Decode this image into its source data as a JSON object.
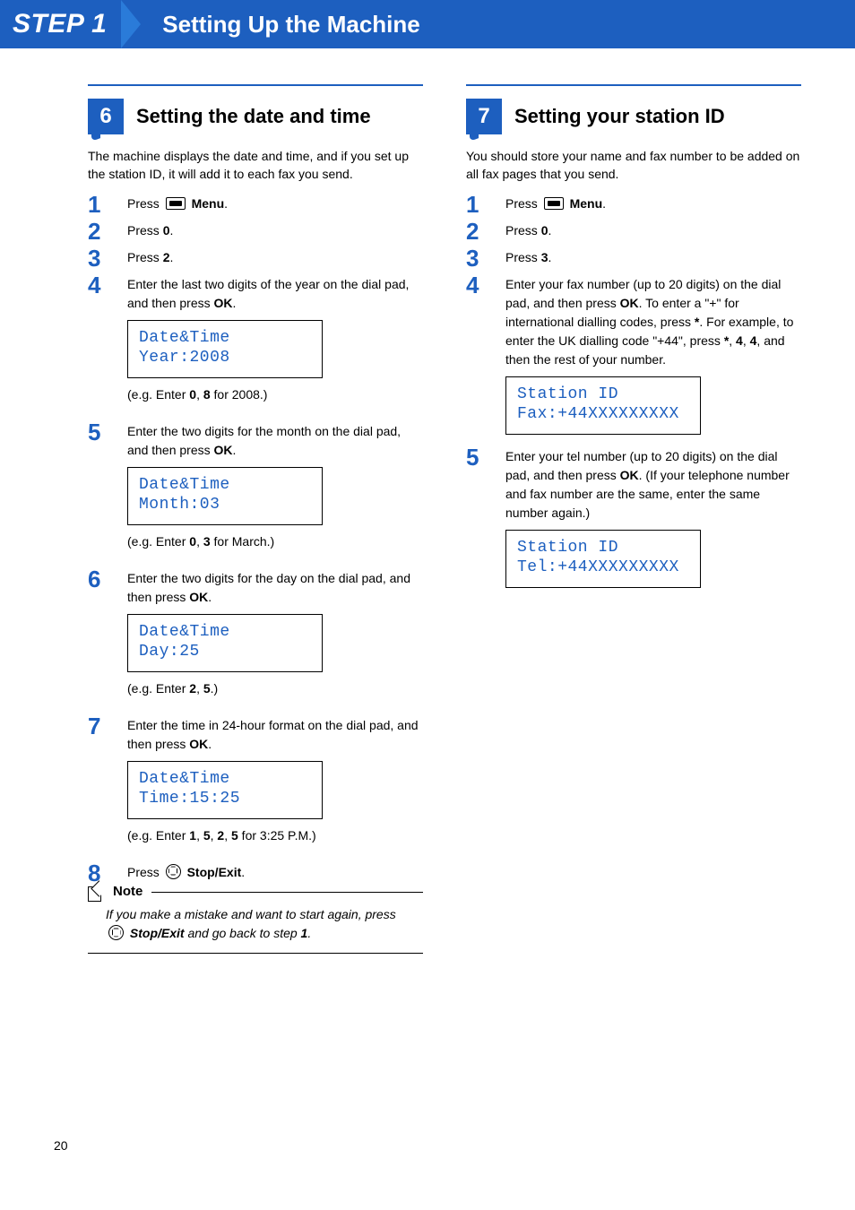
{
  "banner": {
    "step": "STEP 1",
    "title": "Setting Up the Machine"
  },
  "left": {
    "number": "6",
    "title": "Setting the date and time",
    "intro": "The machine displays the date and time, and if you set up the station ID, it will add it to each fax you send.",
    "s1_pre": "Press ",
    "s1_bold": "Menu",
    "s1_post": ".",
    "s2_pre": "Press ",
    "s2_bold": "0",
    "s2_post": ".",
    "s3_pre": "Press ",
    "s3_bold": "2",
    "s3_post": ".",
    "s4_a": "Enter the last two digits of the year on the dial pad, and then press ",
    "s4_b": "OK",
    "s4_c": ".",
    "lcd1_l1": "Date&Time",
    "lcd1_l2": "Year:2008",
    "eg1_a": "(e.g. Enter ",
    "eg1_b": "0",
    "eg1_c": ", ",
    "eg1_d": "8",
    "eg1_e": " for 2008.)",
    "s5_a": "Enter the two digits for the month on the dial pad, and then press ",
    "s5_b": "OK",
    "s5_c": ".",
    "lcd2_l1": "Date&Time",
    "lcd2_l2": "Month:03",
    "eg2_a": "(e.g. Enter ",
    "eg2_b": "0",
    "eg2_c": ", ",
    "eg2_d": "3",
    "eg2_e": " for March.)",
    "s6_a": "Enter the two digits for the day on the dial pad, and then press ",
    "s6_b": "OK",
    "s6_c": ".",
    "lcd3_l1": "Date&Time",
    "lcd3_l2": "Day:25",
    "eg3_a": "(e.g. Enter ",
    "eg3_b": "2",
    "eg3_c": ", ",
    "eg3_d": "5",
    "eg3_e": ".)",
    "s7_a": "Enter the time in 24-hour format on the dial pad, and then press ",
    "s7_b": "OK",
    "s7_c": ".",
    "lcd4_l1": "Date&Time",
    "lcd4_l2": "Time:15:25",
    "eg4_a": "(e.g. Enter ",
    "eg4_b": "1",
    "eg4_c": ", ",
    "eg4_d": "5",
    "eg4_e": ", ",
    "eg4_f": "2",
    "eg4_g": ", ",
    "eg4_h": "5",
    "eg4_i": " for 3:25 P.M.)",
    "s8_pre": "Press ",
    "s8_bold": "Stop/Exit",
    "s8_post": ".",
    "note_title": "Note",
    "note_a": "If you make a mistake and want to start again, press ",
    "note_b": "Stop/Exit",
    "note_c": " and go back to step ",
    "note_d": "1",
    "note_e": "."
  },
  "right": {
    "number": "7",
    "title": "Setting your station ID",
    "intro": "You should store your name and fax number to be added on all fax pages that you send.",
    "s1_pre": "Press ",
    "s1_bold": "Menu",
    "s1_post": ".",
    "s2_pre": "Press ",
    "s2_bold": "0",
    "s2_post": ".",
    "s3_pre": "Press ",
    "s3_bold": "3",
    "s3_post": ".",
    "s4_a": "Enter your fax number (up to 20 digits) on the dial pad, and then press ",
    "s4_b": "OK",
    "s4_c": ". To enter a \"+\" for international dialling codes, press ",
    "s4_d": "*",
    "s4_e": ". For example, to enter the UK dialling code \"+44\", press ",
    "s4_f": "*",
    "s4_g": ", ",
    "s4_h": "4",
    "s4_i": ", ",
    "s4_j": "4",
    "s4_k": ", and then the rest of your number.",
    "lcd1_l1": "Station ID",
    "lcd1_l2": "Fax:+44XXXXXXXXX",
    "s5_a": "Enter your tel number (up to 20 digits) on the dial pad, and then press ",
    "s5_b": "OK",
    "s5_c": ". (If your telephone number and fax number are the same, enter the same number again.)",
    "lcd2_l1": "Station ID",
    "lcd2_l2": "Tel:+44XXXXXXXXX"
  },
  "page_number": "20"
}
